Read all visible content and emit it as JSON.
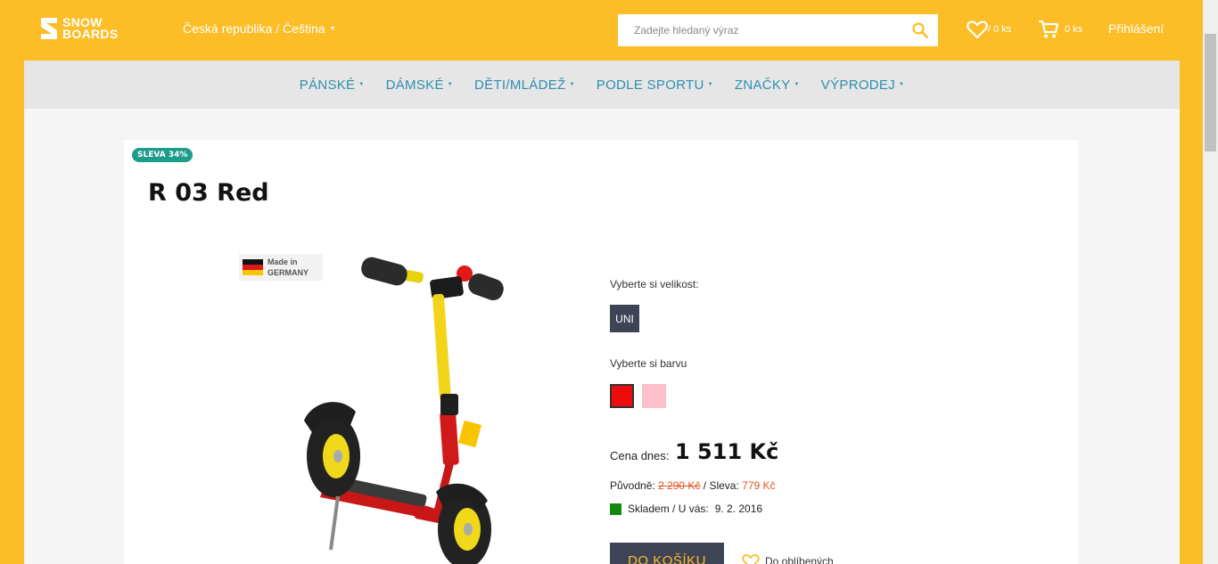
{
  "header": {
    "logo_line1": "SNOW",
    "logo_line2": "BOARDS",
    "locale": "Česká republika / Čeština",
    "search_placeholder": "Zadejte hledaný výraz",
    "favorites_count": "/ 0 ks",
    "cart_count": "0 ks",
    "login": "Přihlášení"
  },
  "nav": {
    "items": [
      "PÁNSKÉ",
      "DÁMSKÉ",
      "DĚTI/MLÁDEŽ",
      "PODLE SPORTU",
      "ZNAČKY",
      "VÝPRODEJ"
    ]
  },
  "product": {
    "badge": "SLEVA 34%",
    "title": "R 03 Red",
    "made_in_line1": "Made in",
    "made_in_line2": "GERMANY",
    "size_label": "Vyberte si velikost:",
    "sizes": [
      "UNI"
    ],
    "color_label": "Vyberte si barvu",
    "colors": [
      "#ee0b0b",
      "#ffc0cb"
    ],
    "price_label": "Cena dnes:",
    "price": "1 511 Kč",
    "original_label": "Původně:",
    "original_price": "2 290 Kč",
    "discount_label": "Sleva:",
    "discount_value": "779 Kč",
    "stock_text": "Skladem / U vás:",
    "stock_date": "9. 2. 2016",
    "add_to_cart": "DO KOŠÍKU",
    "wishlist": "Do oblíbených"
  },
  "colors": {
    "brand_yellow": "#fcbd27",
    "nav_blue": "#2e8fae",
    "dark_button": "#3e4456",
    "badge_teal": "#1e9c8a",
    "discount_orange": "#e0521e",
    "stock_green": "#128a12"
  }
}
